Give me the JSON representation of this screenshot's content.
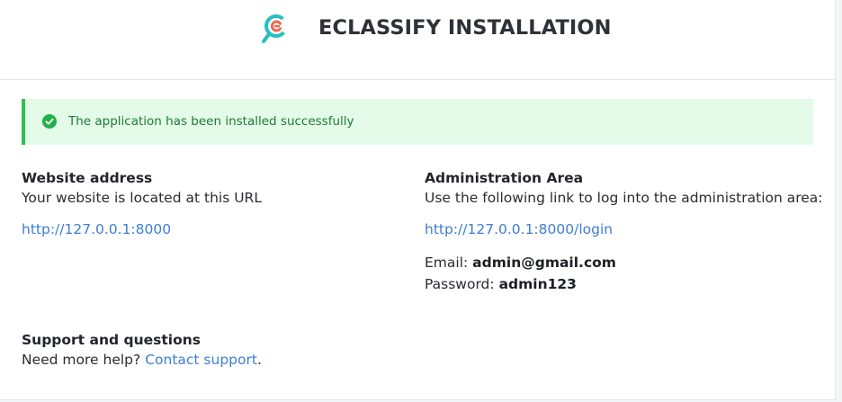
{
  "header": {
    "title": "ECLASSIFY INSTALLATION",
    "logo_icon": "eclassify-logo-icon",
    "accent_colors": [
      "#27bfc1",
      "#ef6a4d"
    ]
  },
  "alert": {
    "icon": "check-circle-icon",
    "message": "The application has been installed successfully",
    "color": "#2fbf55"
  },
  "website": {
    "heading": "Website address",
    "description": "Your website is located at this URL",
    "url": "http://127.0.0.1:8000"
  },
  "admin": {
    "heading": "Administration Area",
    "description": "Use the following link to log into the administration area:",
    "url": "http://127.0.0.1:8000/login",
    "email_label": "Email:",
    "email_value": "admin@gmail.com",
    "password_label": "Password:",
    "password_value": "admin123"
  },
  "support": {
    "heading": "Support and questions",
    "text_prefix": "Need more help?",
    "link_text": "Contact support",
    "text_suffix": "."
  }
}
